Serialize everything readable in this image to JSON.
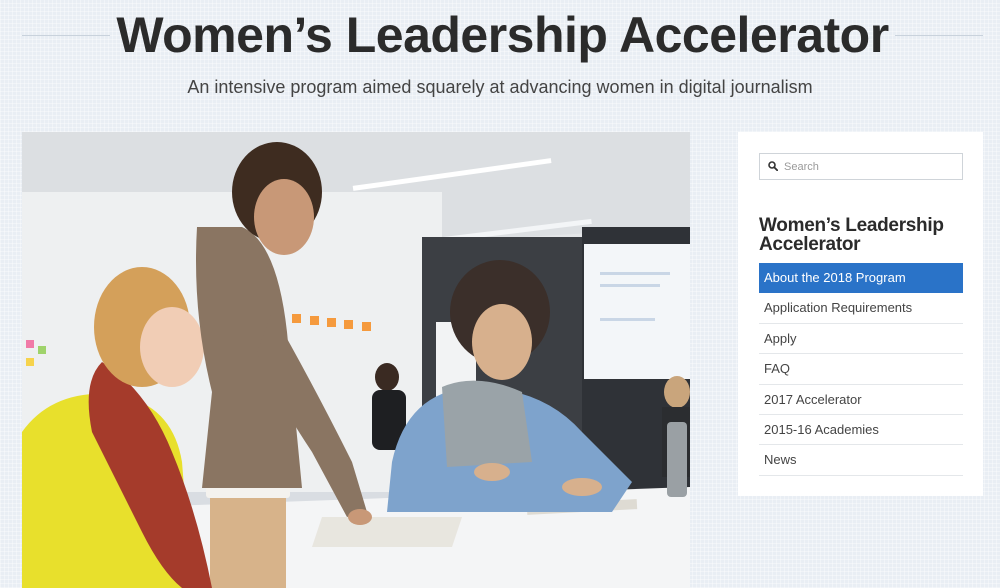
{
  "header": {
    "title": "Women’s Leadership Accelerator",
    "tagline": "An intensive program aimed squarely at advancing women in digital journalism"
  },
  "hero": {
    "icon": "photo-workshop"
  },
  "sidebar": {
    "search": {
      "placeholder": "Search",
      "value": "",
      "icon": "search-icon"
    },
    "widget_title": "Women’s Leadership Accelerator",
    "nav": [
      {
        "label": "About the 2018 Program",
        "active": true
      },
      {
        "label": "Application Requirements",
        "active": false
      },
      {
        "label": "Apply",
        "active": false
      },
      {
        "label": "FAQ",
        "active": false
      },
      {
        "label": "2017 Accelerator",
        "active": false
      },
      {
        "label": "2015-16 Academies",
        "active": false
      },
      {
        "label": "News",
        "active": false
      }
    ]
  },
  "colors": {
    "accent": "#2a73c8",
    "title_text": "#2b2b2b",
    "background": "#e9eef4"
  }
}
